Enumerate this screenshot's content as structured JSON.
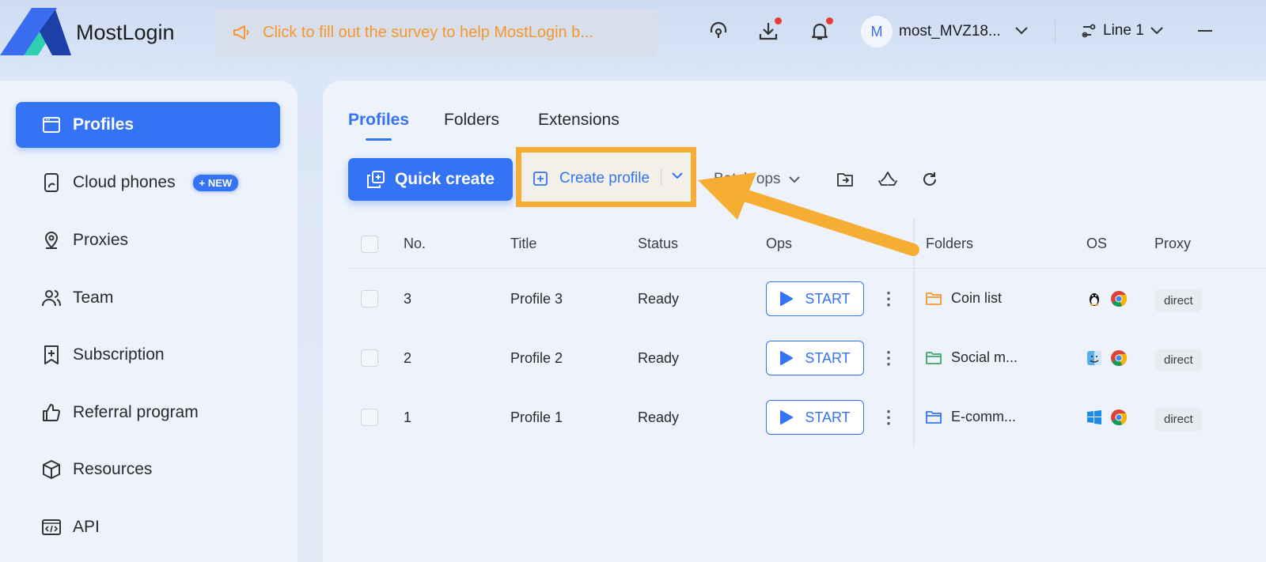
{
  "app": {
    "name": "MostLogin"
  },
  "header": {
    "survey_text": "Click to fill out the survey to help MostLogin b...",
    "user": {
      "avatar_letter": "M",
      "name": "most_MVZ18..."
    },
    "line": "Line 1"
  },
  "sidebar": {
    "items": [
      {
        "label": "Profiles",
        "icon": "browser-window-icon",
        "active": true
      },
      {
        "label": "Cloud phones",
        "icon": "phone-icon",
        "badge": "+ NEW"
      },
      {
        "label": "Proxies",
        "icon": "location-pin-icon"
      },
      {
        "label": "Team",
        "icon": "team-icon"
      },
      {
        "label": "Subscription",
        "icon": "bookmark-plus-icon"
      },
      {
        "label": "Referral program",
        "icon": "thumbs-up-icon"
      },
      {
        "label": "Resources",
        "icon": "cube-icon"
      },
      {
        "label": "API",
        "icon": "code-icon"
      }
    ]
  },
  "tabs": [
    {
      "label": "Profiles",
      "active": true
    },
    {
      "label": "Folders"
    },
    {
      "label": "Extensions"
    }
  ],
  "toolbar": {
    "quick_create": "Quick create",
    "create_profile": "Create profile",
    "batch_ops": "Batch ops"
  },
  "table": {
    "columns": [
      "No.",
      "Title",
      "Status",
      "Ops",
      "Folders",
      "OS",
      "Proxy"
    ],
    "start_label": "START",
    "rows": [
      {
        "no": "3",
        "title": "Profile 3",
        "status": "Ready",
        "folder": "Coin list",
        "folder_color": "#f5962e",
        "os": "linux-icon",
        "proxy": "direct"
      },
      {
        "no": "2",
        "title": "Profile 2",
        "status": "Ready",
        "folder": "Social m...",
        "folder_color": "#3aa867",
        "os": "macos-icon",
        "proxy": "direct"
      },
      {
        "no": "1",
        "title": "Profile 1",
        "status": "Ready",
        "folder": "E-comm...",
        "folder_color": "#3474f4",
        "os": "windows-icon",
        "proxy": "direct"
      }
    ]
  },
  "colors": {
    "accent": "#3474f4",
    "highlight": "#f6ad33",
    "survey": "#f5962e"
  }
}
